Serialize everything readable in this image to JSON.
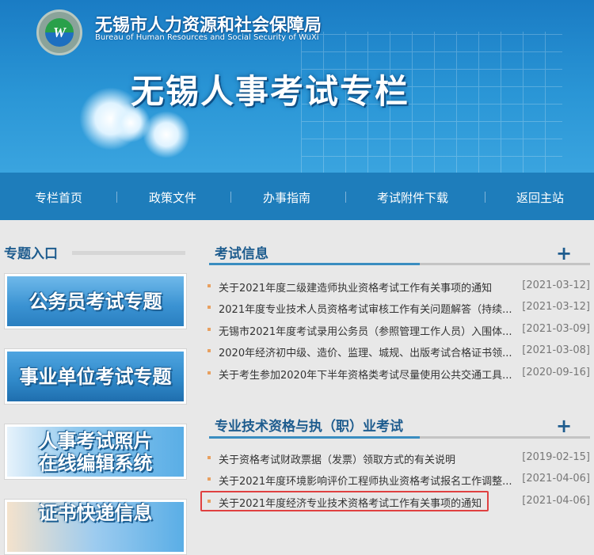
{
  "header": {
    "org_cn": "无锡市人力资源和社会保障局",
    "org_en": "Bureau of Human Resources and Social Security of WuXi",
    "title": "无锡人事考试专栏",
    "logo_letter": "W"
  },
  "nav": [
    "专栏首页",
    "政策文件",
    "办事指南",
    "考试附件下载",
    "返回主站"
  ],
  "sidebar": {
    "title": "专题入口",
    "cards": [
      "公务员考试专题",
      "事业单位考试专题",
      "人事考试照片\n在线编辑系统",
      "证书快递信息"
    ]
  },
  "sections": [
    {
      "title": "考试信息",
      "more": "+",
      "items": [
        {
          "title": "关于2021年度二级建造师执业资格考试工作有关事项的通知",
          "date": "[2021-03-12]"
        },
        {
          "title": "2021年度专业技术人员资格考试审核工作有关问题解答（持续...",
          "date": "[2021-03-12]"
        },
        {
          "title": "无锡市2021年度考试录用公务员（参照管理工作人员）入围体...",
          "date": "[2021-03-09]"
        },
        {
          "title": "2020年经济初中级、造价、监理、城规、出版考试合格证书领...",
          "date": "[2021-03-08]"
        },
        {
          "title": "关于考生参加2020年下半年资格类考试尽量使用公共交通工具...",
          "date": "[2020-09-16]"
        }
      ]
    },
    {
      "title": "专业技术资格与执（职）业考试",
      "more": "+",
      "items": [
        {
          "title": "关于资格考试财政票据（发票）领取方式的有关说明",
          "date": "[2019-02-15]"
        },
        {
          "title": "关于2021年度环境影响评价工程师执业资格考试报名工作调整...",
          "date": "[2021-04-06]"
        },
        {
          "title": "关于2021年度经济专业技术资格考试工作有关事项的通知",
          "date": "[2021-04-06]"
        }
      ]
    }
  ]
}
